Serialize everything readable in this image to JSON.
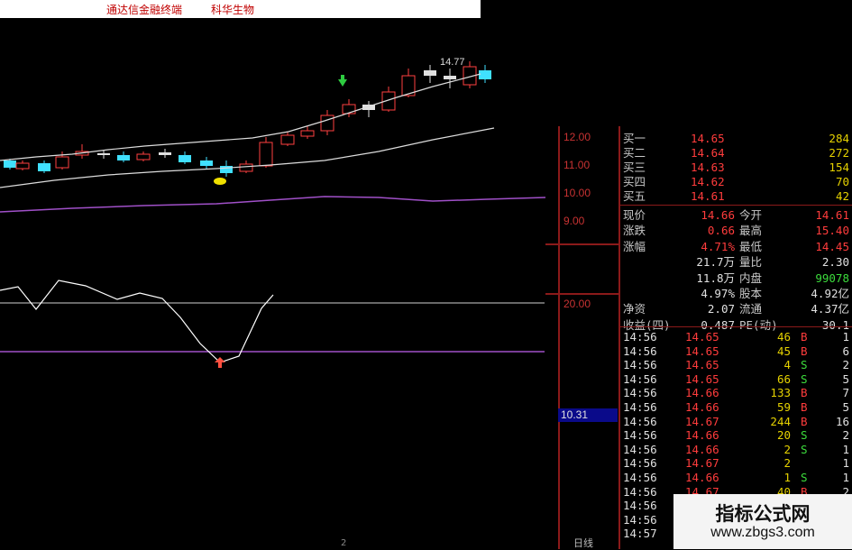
{
  "window": {
    "title_left": "通达信金融终端",
    "title_right": "科华生物"
  },
  "chart": {
    "high_label": "14.77",
    "price_ticks": [
      "12.00",
      "11.00",
      "10.00",
      "9.00"
    ],
    "indicator_level": "20.00",
    "indicator_value": "10.31",
    "period_tab": "日线",
    "bottom_tick": "2"
  },
  "orderbook": [
    {
      "label": "买一",
      "price": "14.65",
      "vol": "284"
    },
    {
      "label": "买二",
      "price": "14.64",
      "vol": "272"
    },
    {
      "label": "买三",
      "price": "14.63",
      "vol": "154"
    },
    {
      "label": "买四",
      "price": "14.62",
      "vol": "70"
    },
    {
      "label": "买五",
      "price": "14.61",
      "vol": "42"
    }
  ],
  "stats": [
    {
      "l1": "现价",
      "v1": "14.66",
      "l2": "今开",
      "v2": "14.61"
    },
    {
      "l1": "涨跌",
      "v1": "0.66",
      "l2": "最高",
      "v2": "15.40"
    },
    {
      "l1": "涨幅",
      "v1": "4.71%",
      "l2": "最低",
      "v2": "14.45"
    },
    {
      "l1": "",
      "v1": "21.7万",
      "l2": "量比",
      "v2": "2.30"
    },
    {
      "l1": "",
      "v1": "11.8万",
      "l2": "内盘",
      "v2": "99078"
    },
    {
      "l1": "",
      "v1": "4.97%",
      "l2": "股本",
      "v2": "4.92亿"
    },
    {
      "l1": "净资",
      "v1": "2.07",
      "l2": "流通",
      "v2": "4.37亿"
    },
    {
      "l1": "收益(四)",
      "v1": "0.487",
      "l2": "PE(动)",
      "v2": "30.1"
    }
  ],
  "ticks": [
    {
      "time": "14:56",
      "price": "14.65",
      "vol": "46",
      "side": "B",
      "n": "1"
    },
    {
      "time": "14:56",
      "price": "14.65",
      "vol": "45",
      "side": "B",
      "n": "6"
    },
    {
      "time": "14:56",
      "price": "14.65",
      "vol": "4",
      "side": "S",
      "n": "2"
    },
    {
      "time": "14:56",
      "price": "14.65",
      "vol": "66",
      "side": "S",
      "n": "5"
    },
    {
      "time": "14:56",
      "price": "14.66",
      "vol": "133",
      "side": "B",
      "n": "7"
    },
    {
      "time": "14:56",
      "price": "14.66",
      "vol": "59",
      "side": "B",
      "n": "5"
    },
    {
      "time": "14:56",
      "price": "14.67",
      "vol": "244",
      "side": "B",
      "n": "16"
    },
    {
      "time": "14:56",
      "price": "14.66",
      "vol": "20",
      "side": "S",
      "n": "2"
    },
    {
      "time": "14:56",
      "price": "14.66",
      "vol": "2",
      "side": "S",
      "n": "1"
    },
    {
      "time": "14:56",
      "price": "14.67",
      "vol": "2",
      "side": "",
      "n": "1"
    },
    {
      "time": "14:56",
      "price": "14.66",
      "vol": "1",
      "side": "S",
      "n": "1"
    },
    {
      "time": "14:56",
      "price": "14.67",
      "vol": "40",
      "side": "B",
      "n": "2"
    },
    {
      "time": "14:56",
      "price": "",
      "vol": "",
      "side": "",
      "n": ""
    },
    {
      "time": "14:56",
      "price": "",
      "vol": "",
      "side": "",
      "n": ""
    },
    {
      "time": "14:57",
      "price": "",
      "vol": "",
      "side": "",
      "n": ""
    }
  ],
  "watermark": {
    "line1": "指标公式网",
    "line2": "www.zbgs3.com"
  }
}
